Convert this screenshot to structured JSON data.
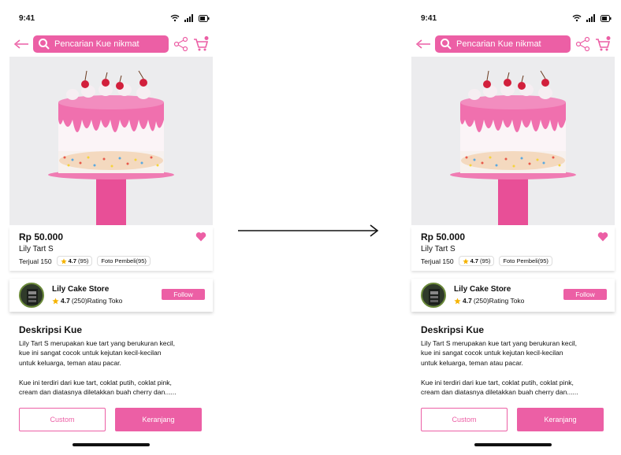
{
  "status": {
    "time": "9:41"
  },
  "search": {
    "placeholder": "Pencarian Kue nikmat"
  },
  "product": {
    "price": "Rp 50.000",
    "name": "Lily Tart S",
    "sold": "Terjual 150",
    "rating": "4.7",
    "rating_count": "(95)",
    "buyer_photos": "Foto Pembeli(95)"
  },
  "store": {
    "name": "Lily Cake Store",
    "rating": "4.7",
    "rating_detail": "(250)Rating Toko",
    "follow_label": "Follow"
  },
  "description": {
    "title": "Deskripsi Kue",
    "body": "Lily Tart S merupakan kue tart yang berukuran kecil,\nkue ini sangat cocok untuk kejutan kecil-kecilan\nuntuk keluarga, teman atau pacar.\n\nKue ini terdiri dari kue tart, coklat putih, coklat pink,\ncream dan diatasnya diletakkan buah cherry dan......"
  },
  "actions": {
    "custom_label": "Custom",
    "cart_label": "Keranjang"
  },
  "colors": {
    "accent": "#ec5fa5",
    "star": "#f5b301"
  },
  "icons": [
    "back-arrow-icon",
    "search-icon",
    "share-icon",
    "cart-icon",
    "heart-icon",
    "star-icon",
    "wifi-icon",
    "signal-icon",
    "battery-icon"
  ]
}
